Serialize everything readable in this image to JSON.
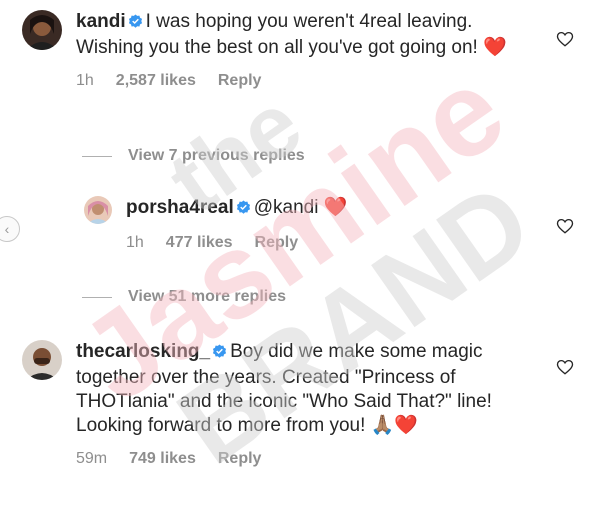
{
  "comments": [
    {
      "username": "kandi",
      "text": "I was hoping you weren't 4real leaving. Wishing you the best on all you've got going on! ❤️",
      "time": "1h",
      "likes": "2,587 likes",
      "reply": "Reply"
    },
    {
      "username": "porsha4real",
      "mention": "@kandi",
      "text_suffix": "❤️",
      "time": "1h",
      "likes": "477 likes",
      "reply": "Reply"
    },
    {
      "username": "thecarlosking_",
      "text": "Boy did we make some magic together over the years. Created \"Princess of THOTlania\" and the iconic \"Who Said That?\" line! Looking forward to more from you! 🙏🏽❤️",
      "time": "59m",
      "likes": "749 likes",
      "reply": "Reply"
    }
  ],
  "view_replies": [
    "View 7 previous replies",
    "View 51 more replies"
  ],
  "watermark": {
    "line1": "the",
    "line2": "Jasmine",
    "line3": "BRAND"
  },
  "colors": {
    "verified": "#3897f0",
    "heart_red": "#ed4956",
    "muted": "#8e8e8e",
    "watermark_pink": "#f6b8c0",
    "watermark_gray": "#cfcfcf"
  },
  "icons": {
    "verified": "verified-badge-icon",
    "like": "heart-outline-icon",
    "back": "chevron-left-icon"
  }
}
